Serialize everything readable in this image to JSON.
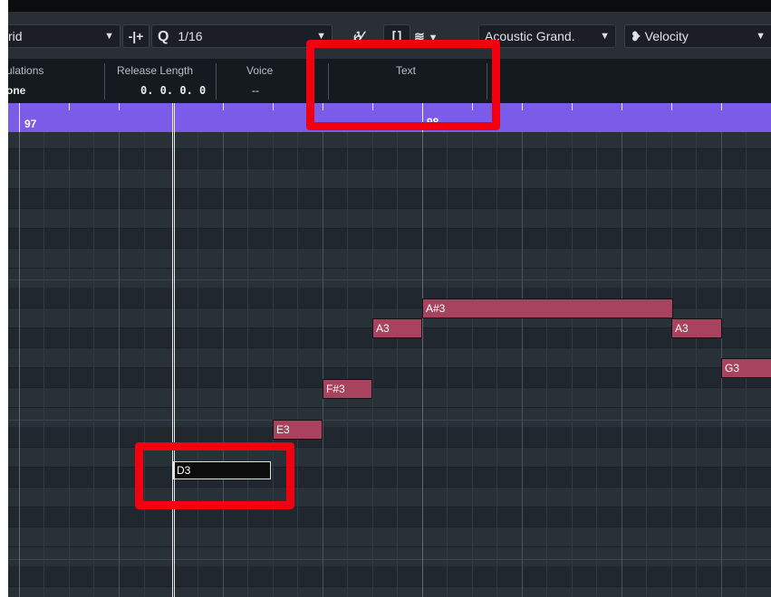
{
  "toolbar": {
    "snap_type": "rid",
    "quantize_label": "1/16",
    "instrument": "Acoustic Grand.",
    "controller": "Velocity"
  },
  "info_line": {
    "articulations_label": "ulations",
    "articulations_value": "one",
    "release_length_label": "Release Length",
    "release_length_value": "0. 0. 0.  0",
    "voice_label": "Voice",
    "voice_value": "--",
    "text_label": "Text"
  },
  "ruler": {
    "bar_97": "97",
    "bar_98": "98"
  },
  "notes": {
    "d3": "D3",
    "e3": "E3",
    "fs3": "F#3",
    "a3_first": "A3",
    "as3": "A#3",
    "a3_second": "A3",
    "g3": "G3"
  },
  "colors": {
    "ruler": "#7a5ce8",
    "note_fill": "#a8435f",
    "highlight": "#f2000f",
    "grid_background": "#283038"
  }
}
